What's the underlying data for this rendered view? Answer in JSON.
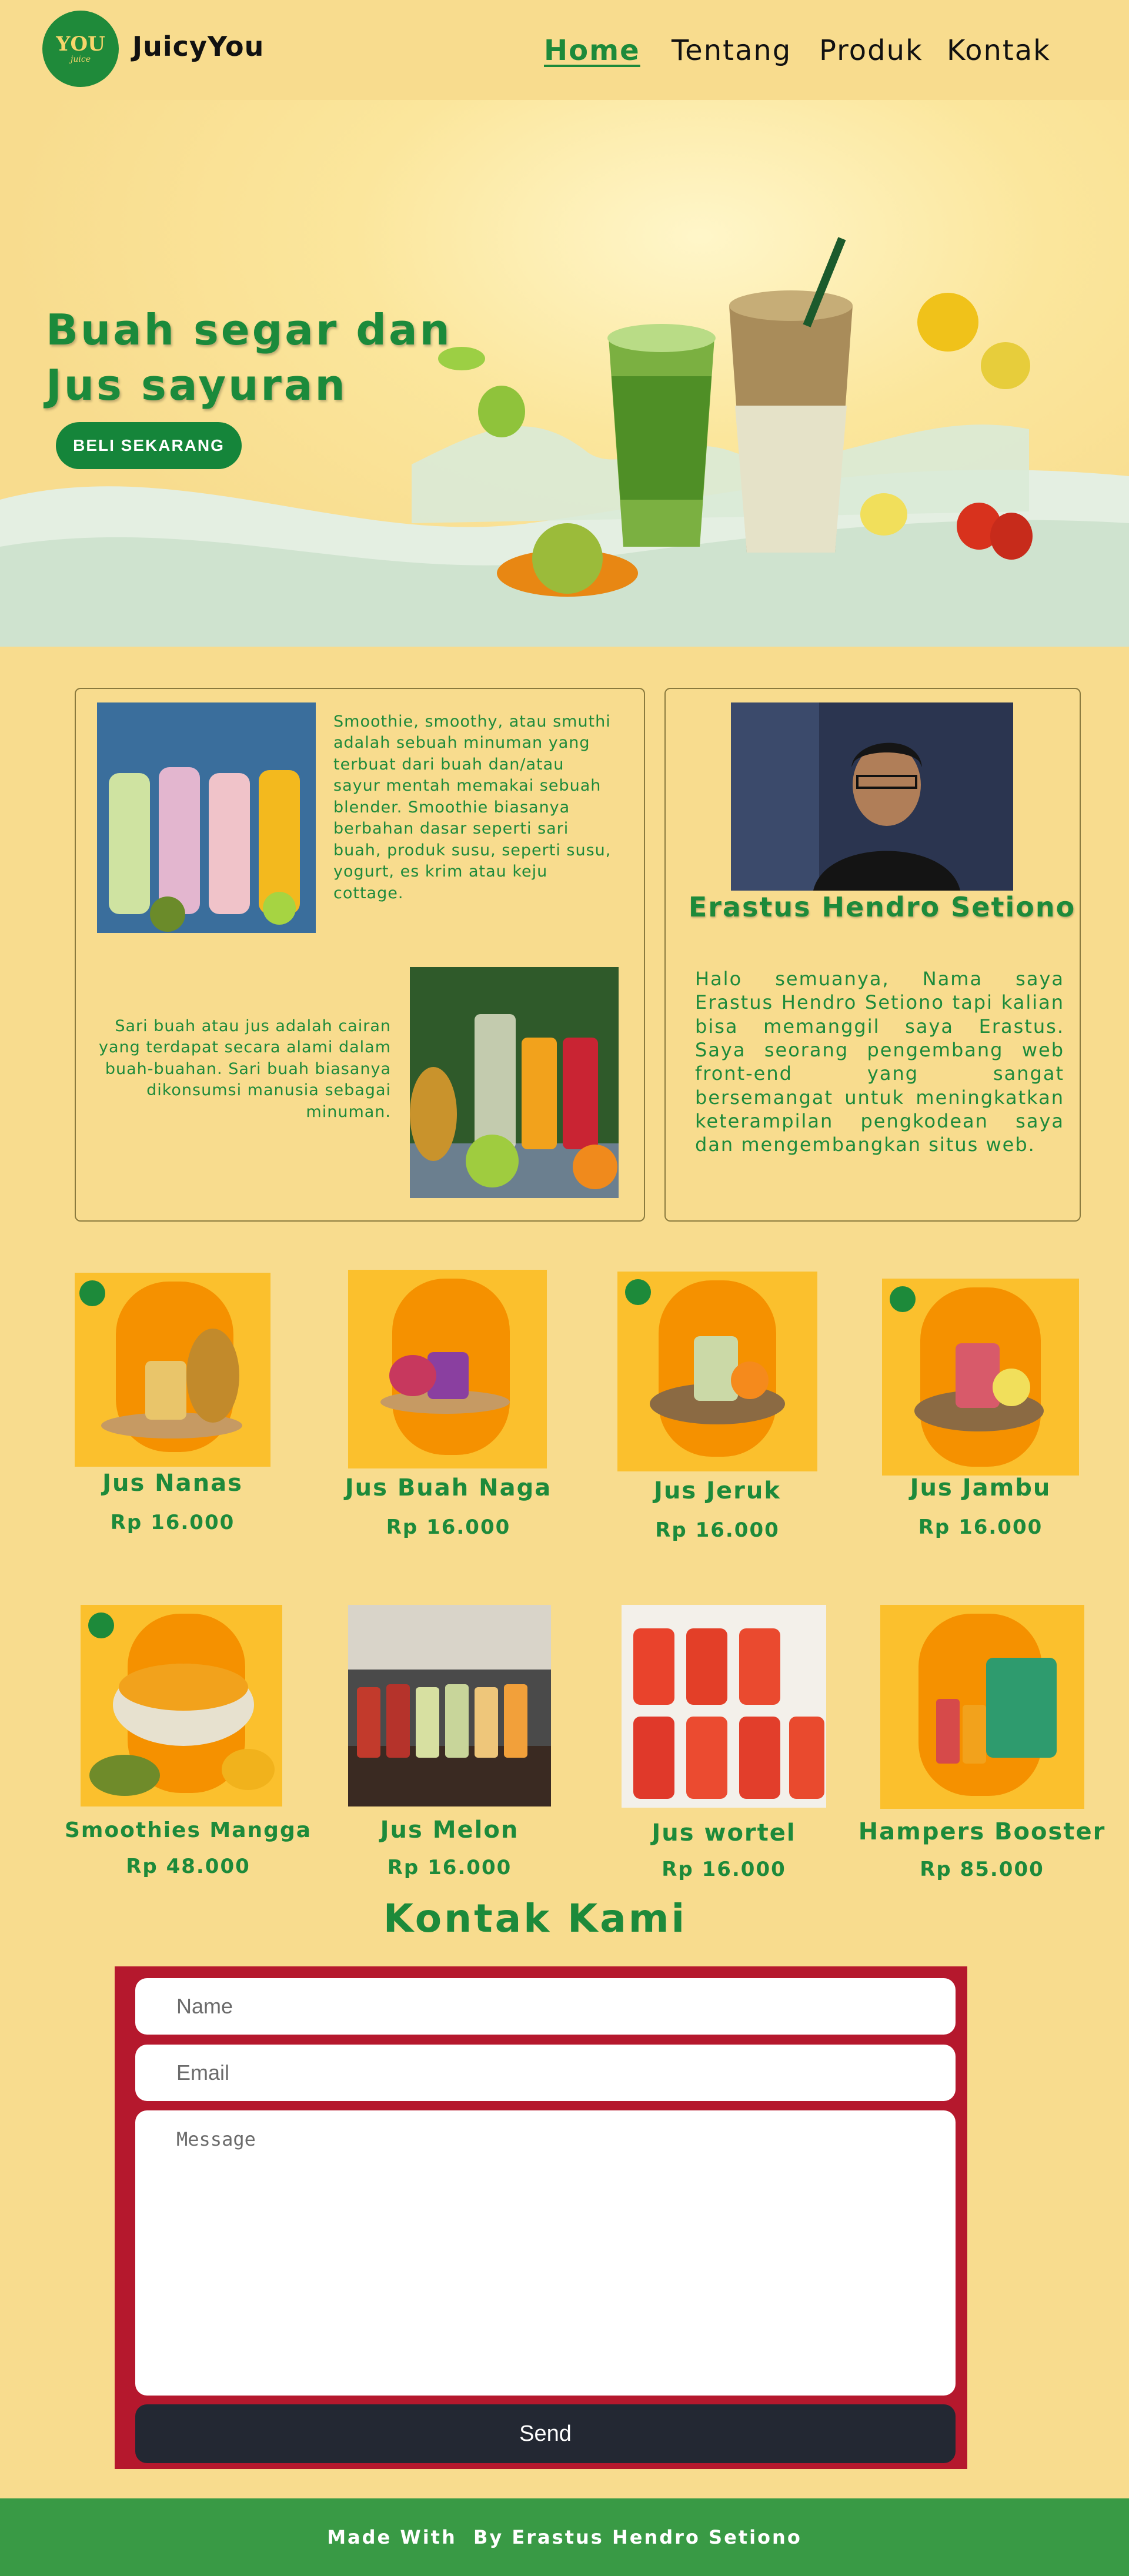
{
  "brand": {
    "logo_text": "YOU",
    "logo_sub": "juice",
    "name": "JuicyYou",
    "colors": {
      "primary_green": "#1d8a3a",
      "background": "#f8dc8e",
      "form_red": "#b5182d",
      "footer_green": "#399a45"
    }
  },
  "nav": {
    "items": [
      {
        "label": "Home",
        "active": true
      },
      {
        "label": "Tentang",
        "active": false
      },
      {
        "label": "Produk",
        "active": false
      },
      {
        "label": "Kontak",
        "active": false
      }
    ]
  },
  "hero": {
    "title_line1": "Buah segar dan",
    "title_line2": "Jus sayuran",
    "cta_label": "BELI SEKARANG"
  },
  "about": {
    "smoothie_text": "Smoothie, smoothy, atau smuthi adalah sebuah minuman yang terbuat dari buah dan/atau sayur mentah memakai sebuah blender. Smoothie biasanya berbahan dasar seperti sari buah, produk susu, seperti susu, yogurt, es krim atau keju cottage.",
    "juice_text": "Sari buah atau jus adalah cairan yang terdapat secara alami dalam buah-buahan. Sari buah biasanya dikonsumsi manusia sebagai minuman."
  },
  "profile": {
    "name": "Erastus Hendro Setiono",
    "bio": "Halo semuanya, Nama saya Erastus Hendro Setiono tapi kalian bisa memanggil saya Erastus. Saya seorang pengembang web front-end yang sangat bersemangat untuk meningkatkan keterampilan pengkodean saya dan mengembangkan situs web."
  },
  "products": [
    {
      "name": "Jus Nanas",
      "price": "Rp 16.000"
    },
    {
      "name": "Jus Buah Naga",
      "price": "Rp 16.000"
    },
    {
      "name": "Jus Jeruk",
      "price": "Rp 16.000"
    },
    {
      "name": "Jus Jambu",
      "price": "Rp 16.000"
    },
    {
      "name": "Smoothies Mangga",
      "price": "Rp 48.000"
    },
    {
      "name": "Jus Melon",
      "price": "Rp 16.000"
    },
    {
      "name": "Jus wortel",
      "price": "Rp 16.000"
    },
    {
      "name": "Hampers Booster",
      "price": "Rp 85.000"
    }
  ],
  "contact": {
    "title": "Kontak Kami",
    "name_placeholder": "Name",
    "email_placeholder": "Email",
    "message_placeholder": "Message",
    "send_label": "Send"
  },
  "footer": {
    "text": "Made With  By Erastus Hendro Setiono"
  }
}
